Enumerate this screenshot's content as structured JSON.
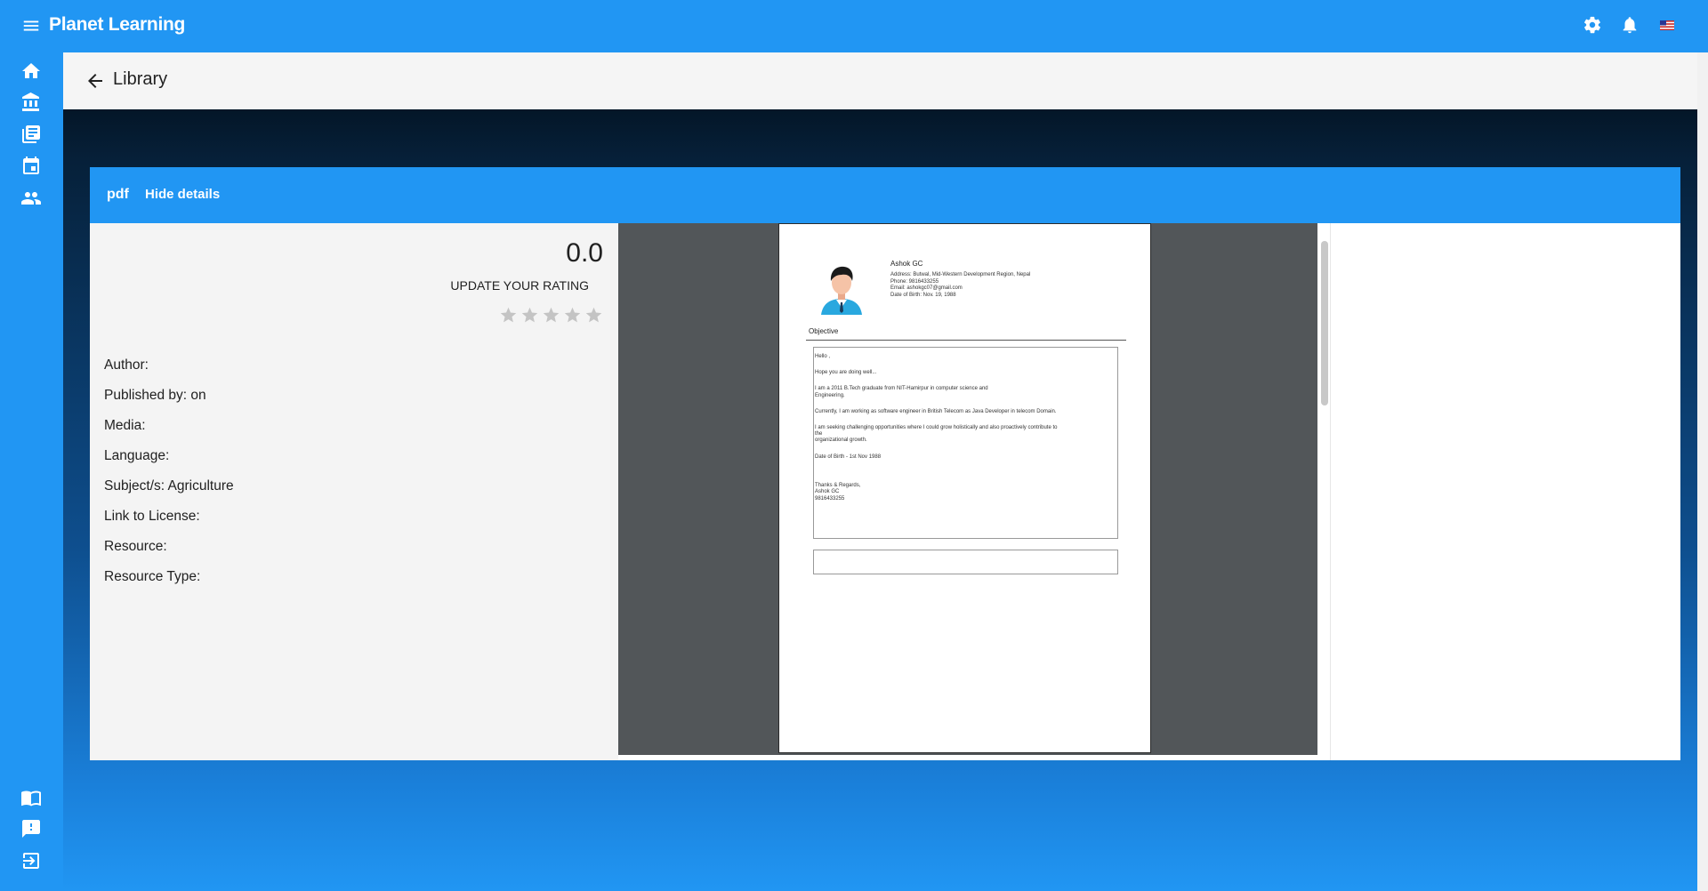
{
  "app": {
    "title": "Planet Learning"
  },
  "topbar": {
    "icons": [
      "settings-icon",
      "notifications-icon",
      "us-flag-icon"
    ]
  },
  "sidenav": {
    "top_icons": [
      "home-icon",
      "library-icon",
      "courses-icon",
      "calendar-icon",
      "community-icon"
    ],
    "bottom_icons": [
      "manual-icon",
      "feedback-icon",
      "logout-icon"
    ]
  },
  "header": {
    "title": "Library"
  },
  "toolbar": {
    "pdf_label": "pdf",
    "hide_details_label": "Hide details"
  },
  "details": {
    "rating_value": "0.0",
    "rating_label": "UPDATE YOUR RATING",
    "stars": 5,
    "rating_stars_filled": 0,
    "fields": [
      "Author:",
      "Published by: on",
      "Media:",
      "Language:",
      "Subject/s: Agriculture",
      "Link to License:",
      "Resource:",
      "Resource Type:"
    ]
  },
  "document": {
    "name": "Ashok GC",
    "info": [
      "Address: Butwal, Mid-Western Development Region, Nepal",
      "Phone: 9816433255",
      "Email: ashokgc07@gmail.com",
      "Date of Birth: Nov. 19, 1988"
    ],
    "section_title": "Objective",
    "paragraphs": [
      "Hello ,",
      "Hope you are doing well...",
      "I am a 2011 B.Tech graduate from NIT-Hamirpur in computer science and\nEngineering.",
      "Currently, I am working as software engineer in British Telecom as Java Developer in telecom Domain.",
      "I am seeking  challenging opportunities where I could grow holistically and also proactively contribute to\nthe\norganizational growth.",
      "Date of Birth - 1st Nov 1988",
      "\n\nThanks & Regards,\nAshok GC\n9816433255"
    ]
  }
}
